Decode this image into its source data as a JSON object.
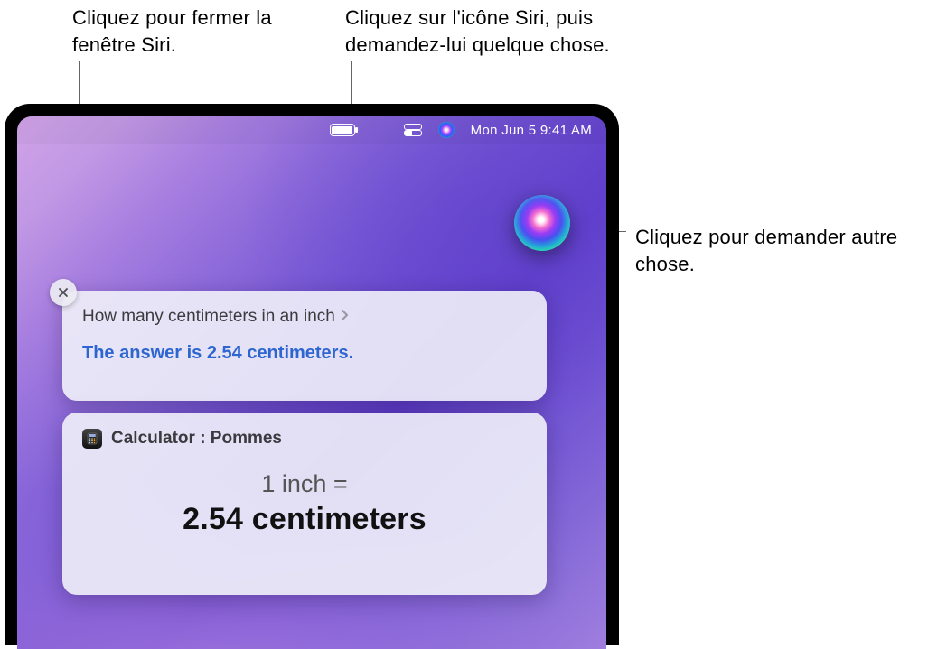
{
  "callouts": {
    "close": "Cliquez pour fermer la fenêtre Siri.",
    "menubar_siri": "Cliquez sur l'icône Siri, puis demandez-lui quelque chose.",
    "orb": "Cliquez pour demander autre chose."
  },
  "menubar": {
    "datetime": "Mon Jun 5  9:41 AM"
  },
  "siri_results": {
    "question": "How many centimeters in an inch",
    "answer": "The answer is 2.54 centimeters.",
    "calculator": {
      "title": "Calculator : Pommes",
      "eq_top": "1 inch =",
      "eq_bottom": "2.54 centimeters"
    }
  }
}
